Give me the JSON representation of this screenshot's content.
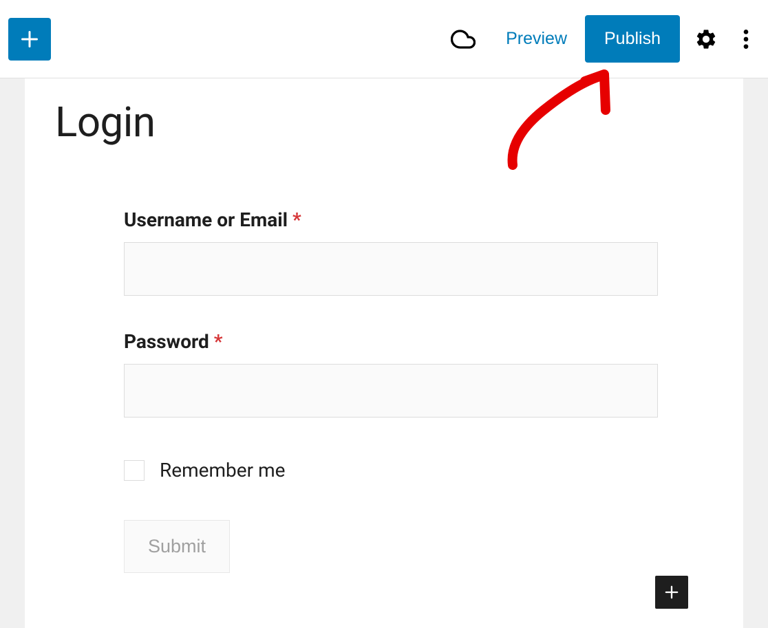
{
  "toolbar": {
    "preview_label": "Preview",
    "publish_label": "Publish"
  },
  "page": {
    "title": "Login"
  },
  "form": {
    "username_label": "Username or Email",
    "password_label": "Password",
    "required_mark": "*",
    "remember_label": "Remember me",
    "submit_label": "Submit"
  },
  "colors": {
    "primary": "#007cba",
    "danger": "#d63638"
  }
}
